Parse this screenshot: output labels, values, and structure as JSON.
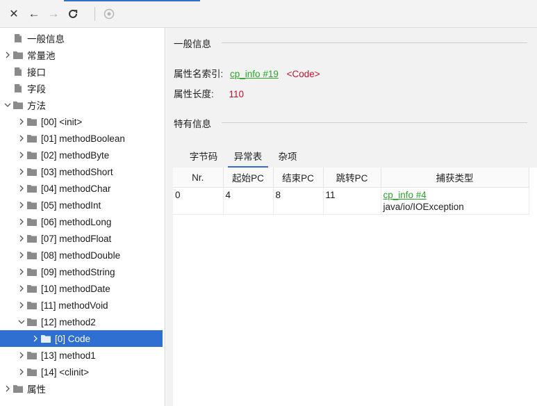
{
  "toolbar": {
    "buttons": [
      {
        "name": "close-icon",
        "glyph": "✕"
      },
      {
        "name": "back-arrow-icon",
        "glyph": "←"
      },
      {
        "name": "forward-arrow-icon",
        "glyph": "→"
      },
      {
        "name": "refresh-icon",
        "glyph": "⟳"
      },
      {
        "name": "globe-icon",
        "glyph": "◉"
      }
    ]
  },
  "tree": [
    {
      "label": "一般信息",
      "icon": "file",
      "level": 0,
      "arrow": ""
    },
    {
      "label": "常量池",
      "icon": "folder",
      "level": 0,
      "arrow": "collapsed"
    },
    {
      "label": "接口",
      "icon": "file",
      "level": 0,
      "arrow": ""
    },
    {
      "label": "字段",
      "icon": "file",
      "level": 0,
      "arrow": ""
    },
    {
      "label": "方法",
      "icon": "folder",
      "level": 0,
      "arrow": "expanded"
    },
    {
      "label": "[00] <init>",
      "icon": "folder",
      "level": 1,
      "arrow": "collapsed"
    },
    {
      "label": "[01] methodBoolean",
      "icon": "folder",
      "level": 1,
      "arrow": "collapsed"
    },
    {
      "label": "[02] methodByte",
      "icon": "folder",
      "level": 1,
      "arrow": "collapsed"
    },
    {
      "label": "[03] methodShort",
      "icon": "folder",
      "level": 1,
      "arrow": "collapsed"
    },
    {
      "label": "[04] methodChar",
      "icon": "folder",
      "level": 1,
      "arrow": "collapsed"
    },
    {
      "label": "[05] methodInt",
      "icon": "folder",
      "level": 1,
      "arrow": "collapsed"
    },
    {
      "label": "[06] methodLong",
      "icon": "folder",
      "level": 1,
      "arrow": "collapsed"
    },
    {
      "label": "[07] methodFloat",
      "icon": "folder",
      "level": 1,
      "arrow": "collapsed"
    },
    {
      "label": "[08] methodDouble",
      "icon": "folder",
      "level": 1,
      "arrow": "collapsed"
    },
    {
      "label": "[09] methodString",
      "icon": "folder",
      "level": 1,
      "arrow": "collapsed"
    },
    {
      "label": "[10] methodDate",
      "icon": "folder",
      "level": 1,
      "arrow": "collapsed"
    },
    {
      "label": "[11] methodVoid",
      "icon": "folder",
      "level": 1,
      "arrow": "collapsed"
    },
    {
      "label": "[12] method2",
      "icon": "folder",
      "level": 1,
      "arrow": "expanded"
    },
    {
      "label": "[0] Code",
      "icon": "folder",
      "level": 2,
      "arrow": "collapsed",
      "selected": true
    },
    {
      "label": "[13] method1",
      "icon": "folder",
      "level": 1,
      "arrow": "collapsed"
    },
    {
      "label": "[14] <clinit>",
      "icon": "folder",
      "level": 1,
      "arrow": "collapsed"
    },
    {
      "label": "属性",
      "icon": "folder",
      "level": 0,
      "arrow": "collapsed"
    }
  ],
  "general": {
    "title": "一般信息",
    "name_index_label": "属性名索引:",
    "name_index_link": "cp_info #19",
    "name_index_value": "<Code>",
    "length_label": "属性长度:",
    "length_value": "110"
  },
  "specific": {
    "title": "特有信息",
    "tabs": [
      "字节码",
      "异常表",
      "杂项"
    ],
    "active_tab": 1
  },
  "exception_table": {
    "columns": [
      "Nr.",
      "起始PC",
      "结束PC",
      "跳转PC",
      "捕获类型"
    ],
    "rows": [
      {
        "nr": "0",
        "start": "4",
        "end": "8",
        "handler": "11",
        "catch_link": "cp_info #4",
        "catch_name": "java/io/IOException"
      }
    ]
  },
  "colors": {
    "accent": "#2f6fd1",
    "link": "#2aa52a",
    "value": "#c8102e"
  }
}
